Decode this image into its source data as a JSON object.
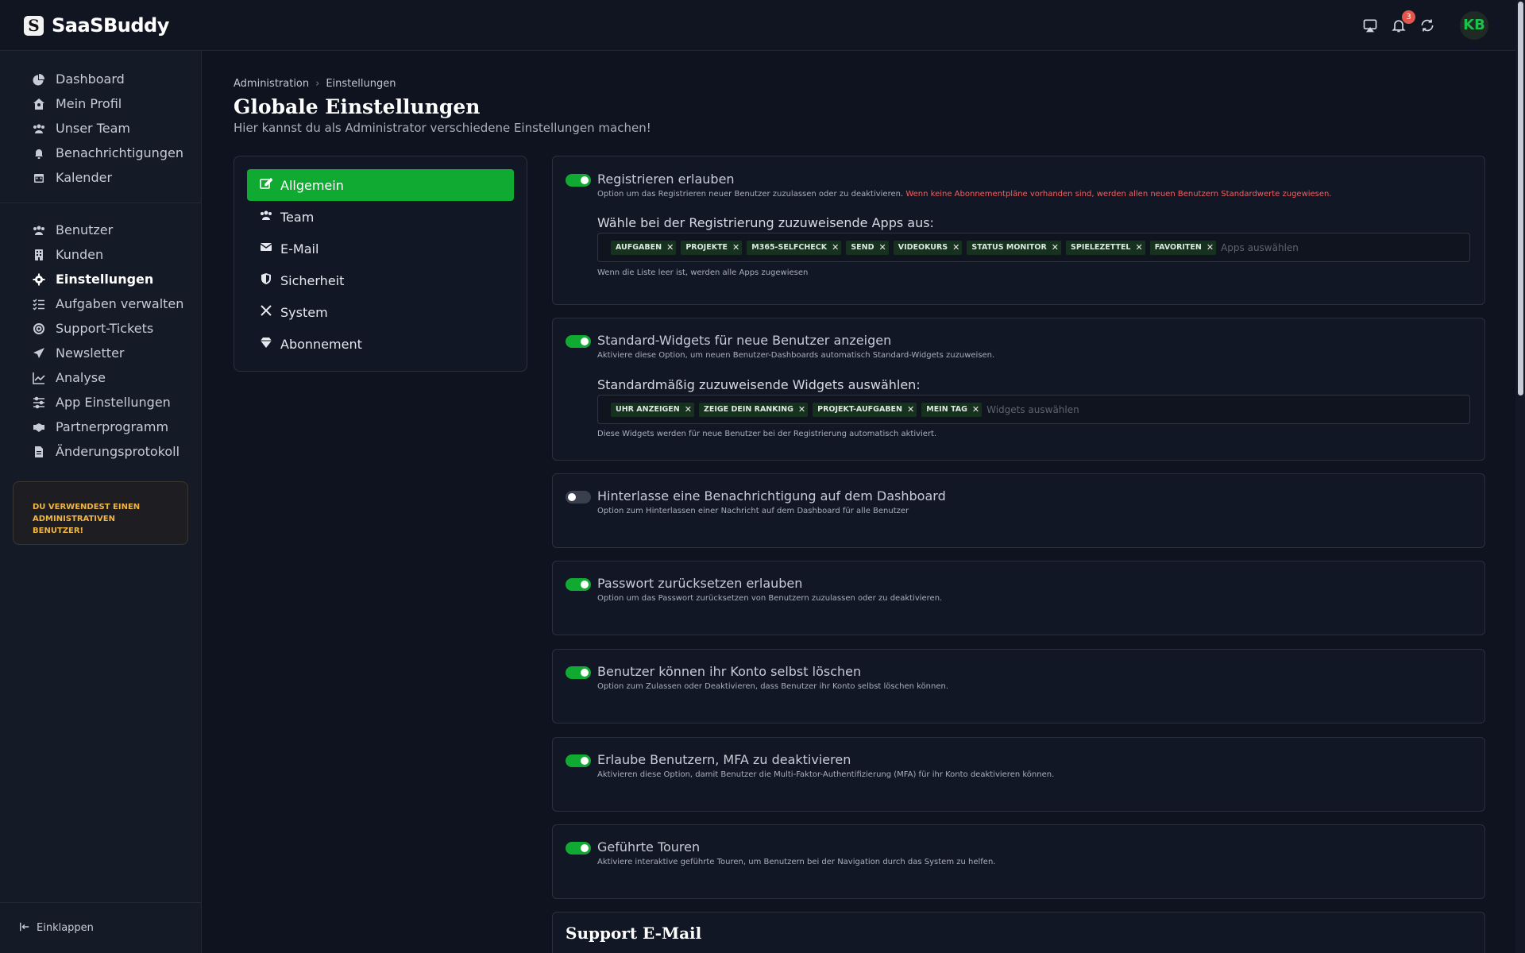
{
  "app": {
    "name": "SaaSBuddy",
    "logo_letter": "S"
  },
  "topbar": {
    "notification_count": "3",
    "avatar_initials": "KB"
  },
  "sidebar": {
    "group1": [
      {
        "label": "Dashboard",
        "icon": "chart-pie-icon"
      },
      {
        "label": "Mein Profil",
        "icon": "home-user-icon"
      },
      {
        "label": "Unser Team",
        "icon": "users-icon"
      },
      {
        "label": "Benachrichtigungen",
        "icon": "bell-icon"
      },
      {
        "label": "Kalender",
        "icon": "calendar-icon"
      }
    ],
    "group2": [
      {
        "label": "Benutzer",
        "icon": "users-icon"
      },
      {
        "label": "Kunden",
        "icon": "building-icon"
      },
      {
        "label": "Einstellungen",
        "icon": "gear-icon",
        "active": true
      },
      {
        "label": "Aufgaben verwalten",
        "icon": "list-check-icon"
      },
      {
        "label": "Support-Tickets",
        "icon": "lifebuoy-icon"
      },
      {
        "label": "Newsletter",
        "icon": "paper-plane-icon"
      },
      {
        "label": "Analyse",
        "icon": "line-chart-icon"
      },
      {
        "label": "App Einstellungen",
        "icon": "sliders-icon"
      },
      {
        "label": "Partnerprogramm",
        "icon": "handshake-icon"
      },
      {
        "label": "Änderungsprotokoll",
        "icon": "file-icon"
      }
    ],
    "admin_notice": "DU VERWENDEST EINEN ADMINISTRATIVEN BENUTZER!",
    "collapse_label": "Einklappen"
  },
  "breadcrumb": {
    "root": "Administration",
    "current": "Einstellungen"
  },
  "page": {
    "title": "Globale Einstellungen",
    "subtitle": "Hier kannst du als Administrator verschiedene Einstellungen machen!"
  },
  "settings_menu": [
    {
      "label": "Allgemein",
      "icon": "edit-icon",
      "active": true
    },
    {
      "label": "Team",
      "icon": "users-icon"
    },
    {
      "label": "E-Mail",
      "icon": "envelope-icon"
    },
    {
      "label": "Sicherheit",
      "icon": "shield-icon"
    },
    {
      "label": "System",
      "icon": "tools-icon"
    },
    {
      "label": "Abonnement",
      "icon": "gem-icon"
    }
  ],
  "settings": {
    "registration": {
      "enabled": true,
      "title": "Registrieren erlauben",
      "desc": "Option um das Registrieren neuer Benutzer zuzulassen oder zu deaktivieren.",
      "warning": "Wenn keine Abonnementpläne vorhanden sind, werden allen neuen Benutzern Standardwerte zugewiesen.",
      "apps_label": "Wähle bei der Registrierung zuzuweisende Apps aus:",
      "apps": [
        "AUFGABEN",
        "PROJEKTE",
        "M365-SELFCHECK",
        "SEND",
        "VIDEOKURS",
        "STATUS MONITOR",
        "SPIELEZETTEL",
        "FAVORITEN"
      ],
      "apps_placeholder": "Apps auswählen",
      "apps_hint": "Wenn die Liste leer ist, werden alle Apps zugewiesen"
    },
    "widgets": {
      "enabled": true,
      "title": "Standard-Widgets für neue Benutzer anzeigen",
      "desc": "Aktiviere diese Option, um neuen Benutzer-Dashboards automatisch Standard-Widgets zuzuweisen.",
      "widgets_label": "Standardmäßig zuzuweisende Widgets auswählen:",
      "widgets": [
        "UHR ANZEIGEN",
        "ZEIGE DEIN RANKING",
        "PROJEKT-AUFGABEN",
        "MEIN TAG"
      ],
      "widgets_placeholder": "Widgets auswählen",
      "widgets_hint": "Diese Widgets werden für neue Benutzer bei der Registrierung automatisch aktiviert."
    },
    "dashboard_notice": {
      "enabled": false,
      "title": "Hinterlasse eine Benachrichtigung auf dem Dashboard",
      "desc": "Option zum Hinterlassen einer Nachricht auf dem Dashboard für alle Benutzer"
    },
    "password_reset": {
      "enabled": true,
      "title": "Passwort zurücksetzen erlauben",
      "desc": "Option um das Passwort zurücksetzen von Benutzern zuzulassen oder zu deaktivieren."
    },
    "delete_account": {
      "enabled": true,
      "title": "Benutzer können ihr Konto selbst löschen",
      "desc": "Option zum Zulassen oder Deaktivieren, dass Benutzer ihr Konto selbst löschen können."
    },
    "mfa": {
      "enabled": true,
      "title": "Erlaube Benutzern, MFA zu deaktivieren",
      "desc": "Aktivieren diese Option, damit Benutzer die Multi-Faktor-Authentifizierung (MFA) für ihr Konto deaktivieren können."
    },
    "tours": {
      "enabled": true,
      "title": "Geführte Touren",
      "desc": "Aktiviere interaktive geführte Touren, um Benutzern bei der Navigation durch das System zu helfen."
    },
    "support_email": {
      "title": "Support E-Mail"
    }
  },
  "colors": {
    "accent": "#10a931",
    "warning": "#f06060",
    "notice": "#f0b544"
  }
}
